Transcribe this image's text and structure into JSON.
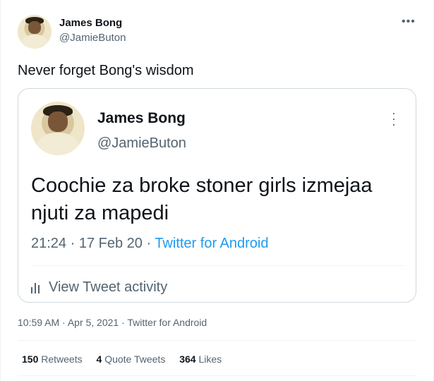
{
  "tweet": {
    "author_name": "James Bong",
    "author_handle": "@JamieButon",
    "more_icon": "more-horizontal-icon",
    "text": "Never forget Bong's wisdom",
    "timestamp": "10:59 AM · Apr 5, 2021 · Twitter for Android"
  },
  "quote": {
    "author_name": "James Bong",
    "author_handle": "@JamieButon",
    "more_icon": "more-vertical-icon",
    "text": "Coochie za broke stoner girls izmejaa njuti za mapedi",
    "time_date": "21:24 · 17 Feb 20 · ",
    "source": "Twitter for Android",
    "activity_label": "View Tweet activity",
    "activity_icon": "bar-chart-icon"
  },
  "stats": {
    "retweets_count": "150",
    "retweets_label": "Retweets",
    "quotes_count": "4",
    "quotes_label": "Quote Tweets",
    "likes_count": "364",
    "likes_label": "Likes"
  },
  "colors": {
    "link": "#1d9bf0",
    "secondary_text": "#536471",
    "border": "#cfd9de"
  }
}
